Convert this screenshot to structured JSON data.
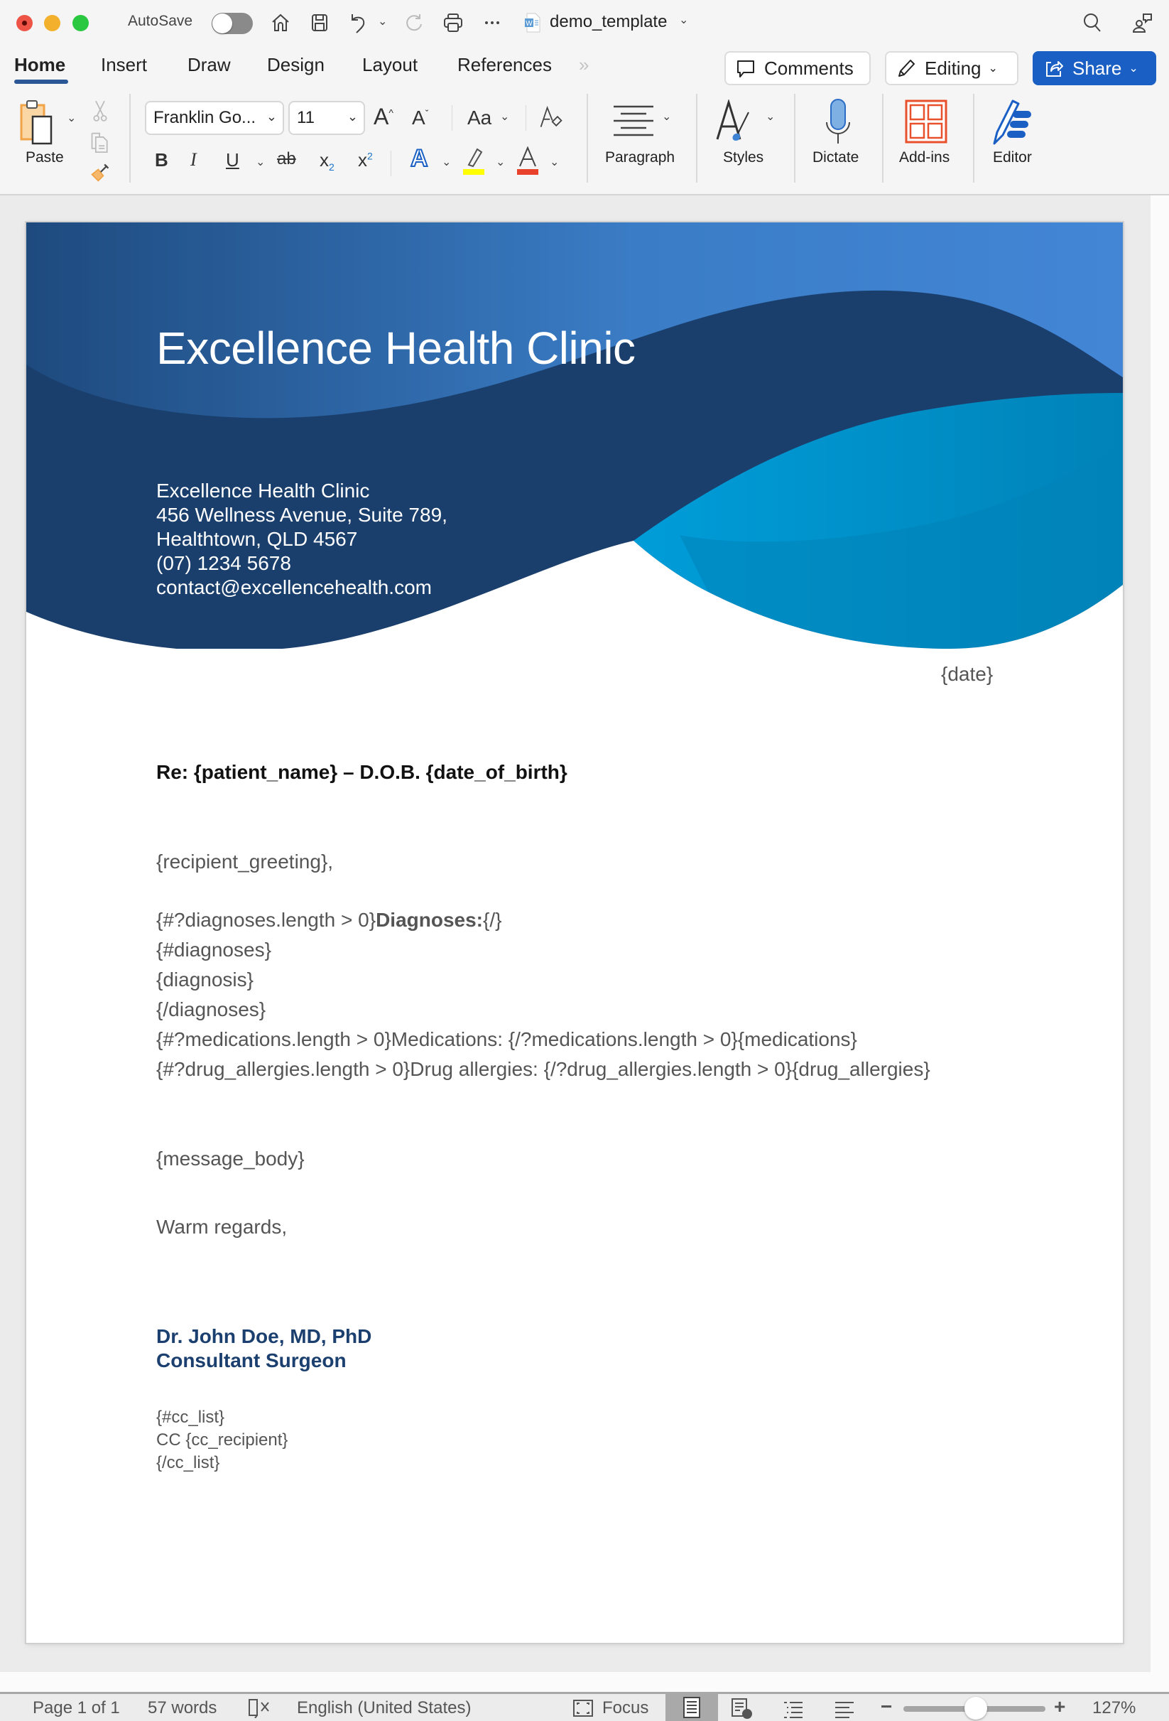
{
  "titlebar": {
    "autosave_label": "AutoSave",
    "autosave_on": false,
    "document_name": "demo_template"
  },
  "tabs": [
    {
      "label": "Home",
      "active": true
    },
    {
      "label": "Insert",
      "active": false
    },
    {
      "label": "Draw",
      "active": false
    },
    {
      "label": "Design",
      "active": false
    },
    {
      "label": "Layout",
      "active": false
    },
    {
      "label": "References",
      "active": false
    }
  ],
  "header_buttons": {
    "comments": "Comments",
    "editing": "Editing",
    "share": "Share"
  },
  "ribbon": {
    "paste_label": "Paste",
    "font_name": "Franklin Go...",
    "font_size": "11",
    "change_case": "Aa",
    "paragraph_label": "Paragraph",
    "styles_label": "Styles",
    "dictate_label": "Dictate",
    "addins_label": "Add-ins",
    "editor_label": "Editor",
    "highlight_color": "#ffff00",
    "font_color": "#e8412c"
  },
  "document": {
    "banner": {
      "title": "Excellence Health Clinic",
      "address_lines": [
        "Excellence Health Clinic",
        "456 Wellness Avenue, Suite 789,",
        "Healthtown, QLD 4567",
        "(07) 1234 5678",
        "contact@excellencehealth.com"
      ],
      "colors": {
        "top_gradient_start": "#1e4a7e",
        "top_gradient_end": "#4285d4",
        "navy_wave": "#1a3f6c",
        "cyan_wave": "#009dd9",
        "cyan_wave_dark": "#0083b8"
      }
    },
    "date": "{date}",
    "re_line": "Re: {patient_name} – D.O.B. {date_of_birth}",
    "greeting": "{recipient_greeting},",
    "diagnoses_line": {
      "prefix": "{#?diagnoses.length > 0}",
      "bold": "Diagnoses:",
      "suffix": "{/}"
    },
    "template_lines": [
      "{#diagnoses}",
      "{diagnosis}",
      "{/diagnoses}",
      "{#?medications.length > 0}Medications: {/?medications.length > 0}{medications}",
      "{#?drug_allergies.length > 0}Drug allergies: {/?drug_allergies.length > 0}{drug_allergies}"
    ],
    "message_body": "{message_body}",
    "closing": "Warm regards,",
    "signature_name": "Dr. John Doe, MD, PhD",
    "signature_title": "Consultant Surgeon",
    "cc_lines": [
      "{#cc_list}",
      "CC {cc_recipient}",
      "{/cc_list}"
    ],
    "signature_color": "#1b3f6e"
  },
  "statusbar": {
    "page": "Page 1 of 1",
    "words": "57 words",
    "language": "English (United States)",
    "focus": "Focus",
    "zoom": "127%",
    "zoom_percent": 127
  }
}
